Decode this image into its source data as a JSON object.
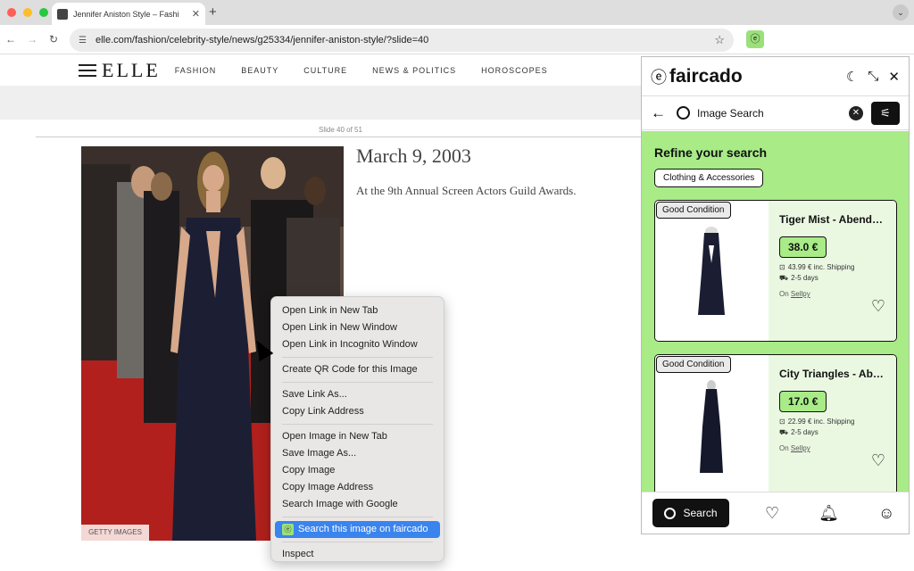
{
  "browser": {
    "tab_title": "Jennifer Aniston Style – Fashi",
    "url": "elle.com/fashion/celebrity-style/news/g25334/jennifer-aniston-style/?slide=40",
    "colors": {
      "dot_close": "#ff5f57",
      "dot_min": "#febc2e",
      "dot_max": "#28c840"
    }
  },
  "site": {
    "logo": "ELLE",
    "nav": [
      "FASHION",
      "BEAUTY",
      "CULTURE",
      "NEWS & POLITICS",
      "HOROSCOPES"
    ],
    "slide_counter": "Slide 40 of 51",
    "photo_credit": "GETTY IMAGES",
    "headline": "March 9, 2003",
    "caption": "At the 9th Annual Screen Actors Guild Awards."
  },
  "context_menu": {
    "groups": [
      [
        "Open Link in New Tab",
        "Open Link in New Window",
        "Open Link in Incognito Window"
      ],
      [
        "Create QR Code for this Image"
      ],
      [
        "Save Link As...",
        "Copy Link Address"
      ],
      [
        "Open Image in New Tab",
        "Save Image As...",
        "Copy Image",
        "Copy Image Address",
        "Search Image with Google"
      ]
    ],
    "highlighted": "Search this image on faircado",
    "last": "Inspect"
  },
  "panel": {
    "logo": "faircado",
    "search_value": "Image Search",
    "refine_title": "Refine your search",
    "chip": "Clothing & Accessories",
    "cards": [
      {
        "condition": "Good Condition",
        "title": "Tiger Mist - Abendkl...",
        "price": "38.0 €",
        "shipping": "43.99 € inc. Shipping",
        "delivery": "2-5 days",
        "source_prefix": "On",
        "source": "Sellpy"
      },
      {
        "condition": "Good Condition",
        "title": "City Triangles - Abe...",
        "price": "17.0 €",
        "shipping": "22.99 € inc. Shipping",
        "delivery": "2-5 days",
        "source_prefix": "On",
        "source": "Sellpy"
      }
    ],
    "footer_search": "Search",
    "accent": "#a8eb87"
  }
}
